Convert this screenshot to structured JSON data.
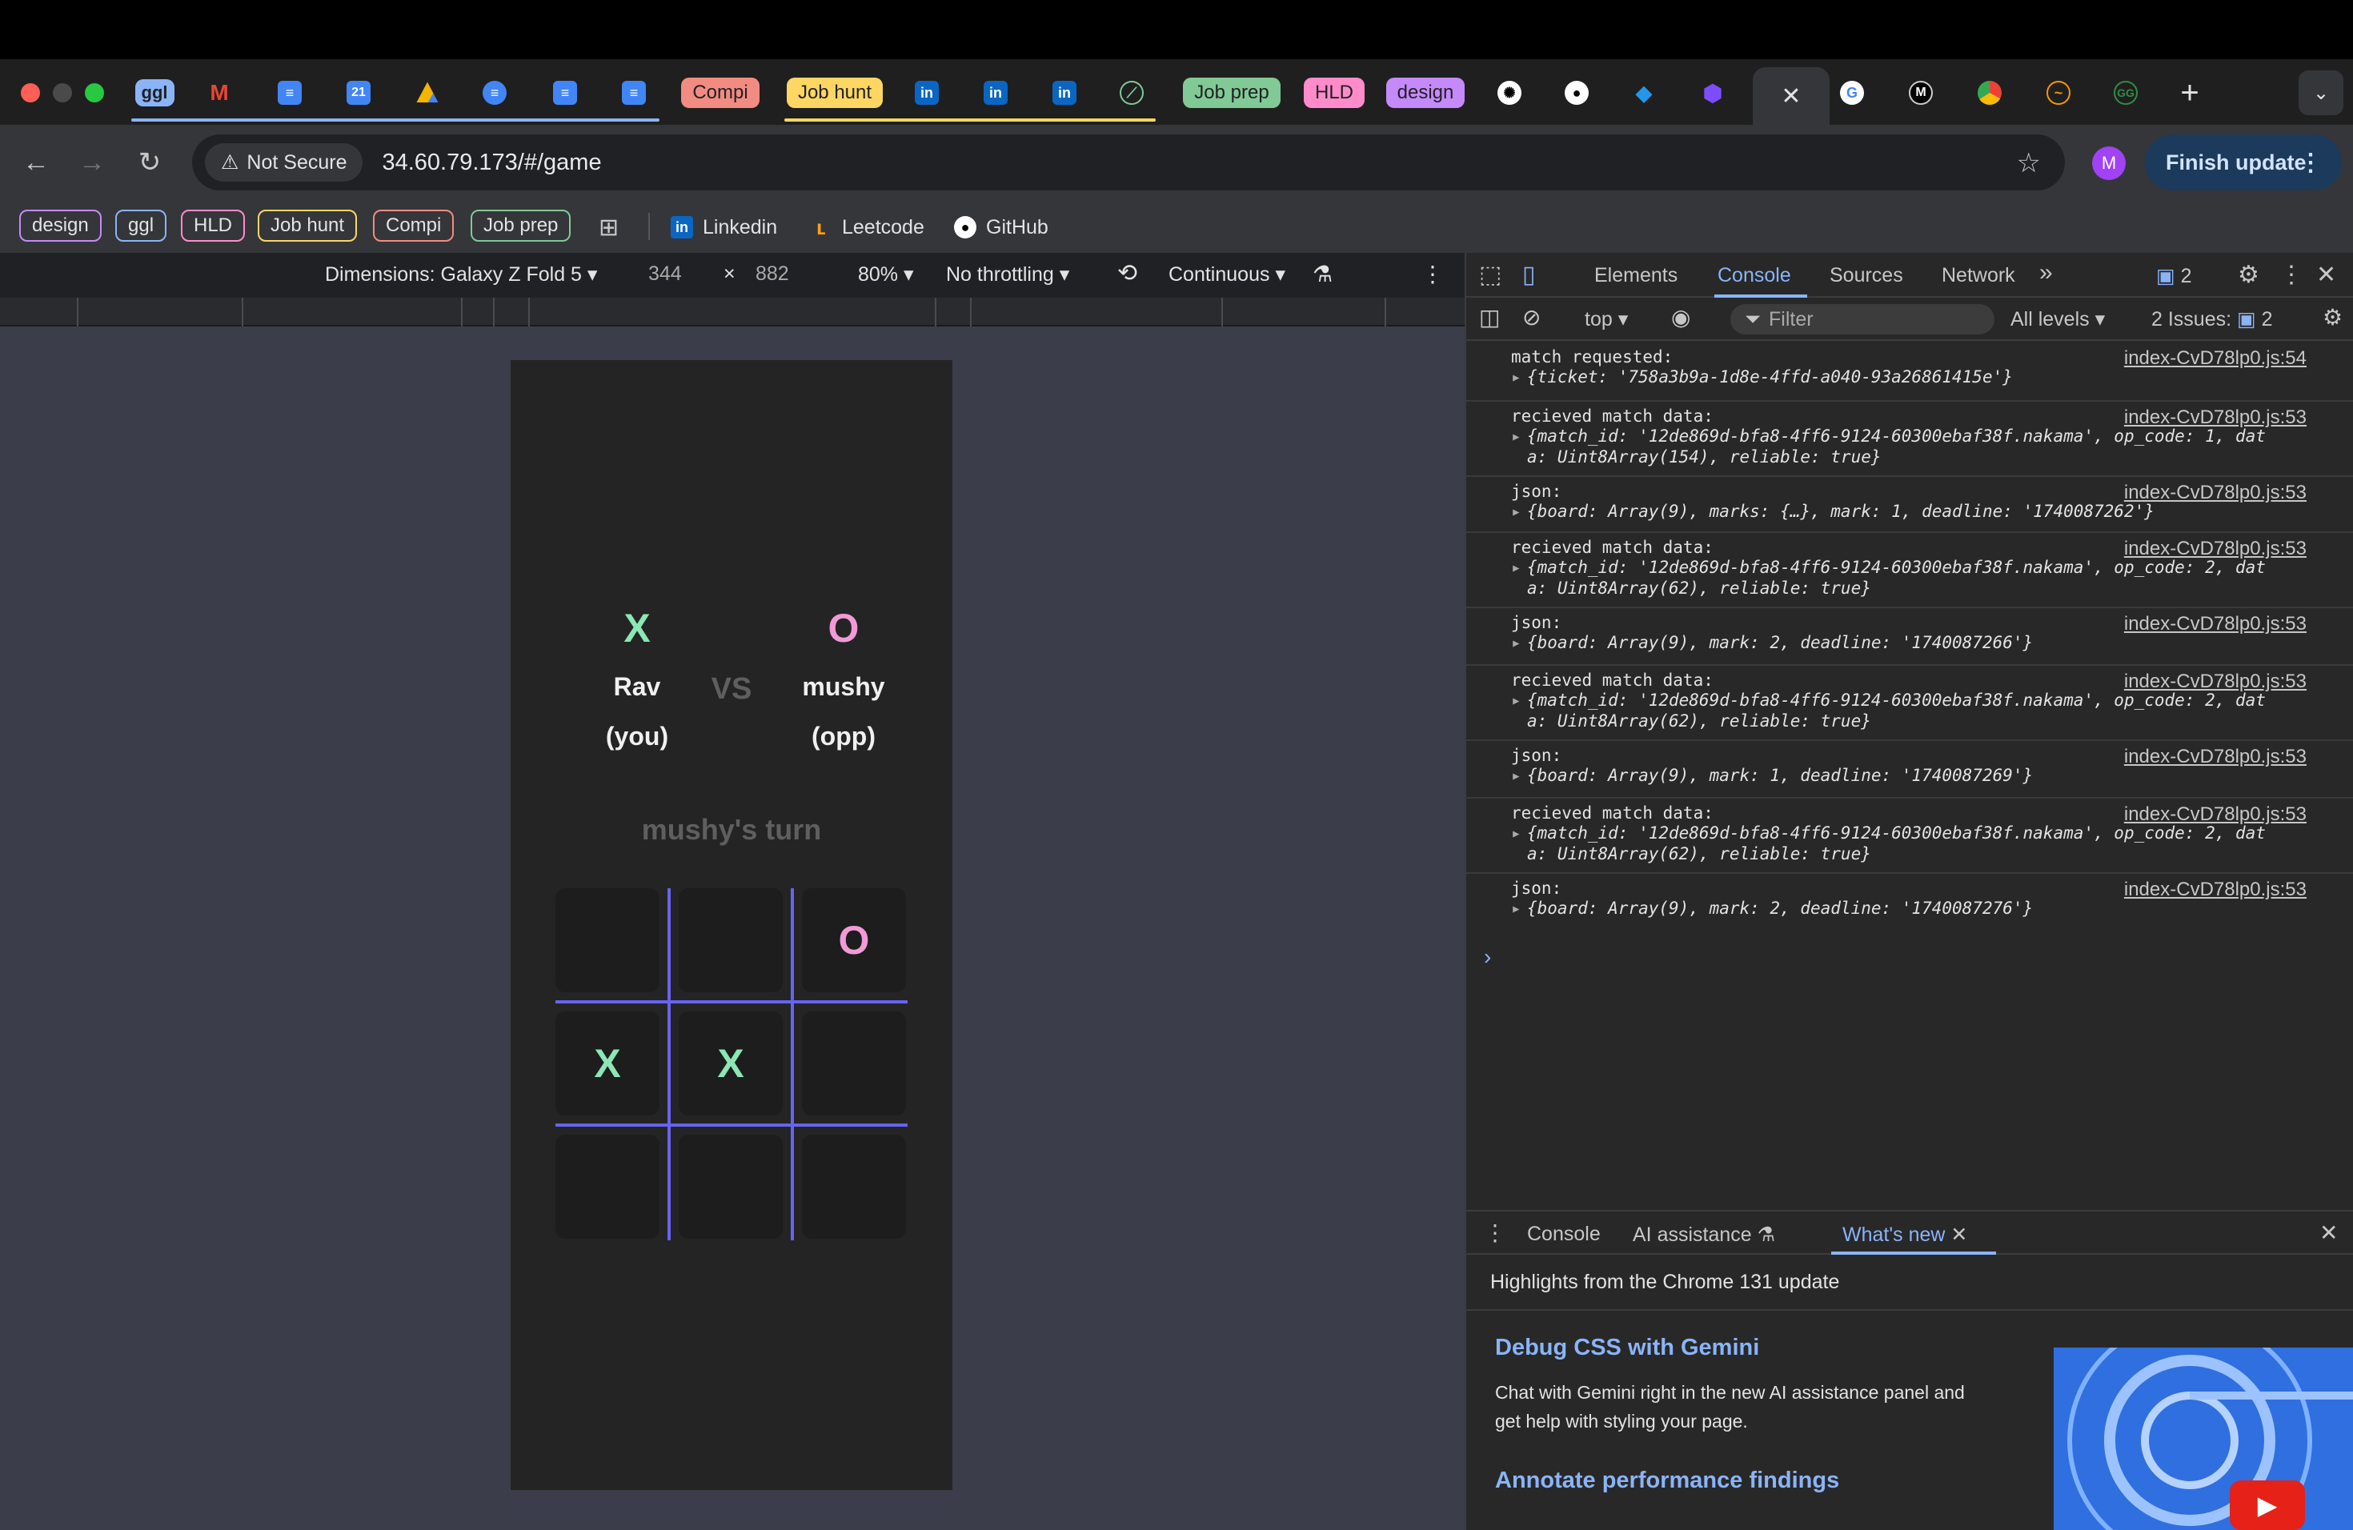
{
  "tabs": {
    "groups": [
      {
        "label": "ggl",
        "bg": "#8ab4f8",
        "fg": "#202124"
      },
      {
        "label": "Compi",
        "bg": "#f28b82",
        "fg": "#202124"
      },
      {
        "label": "Job hunt",
        "bg": "#fdd663",
        "fg": "#202124"
      },
      {
        "label": "Job prep",
        "bg": "#81c995",
        "fg": "#202124"
      },
      {
        "label": "HLD",
        "bg": "#ff8bcb",
        "fg": "#202124"
      },
      {
        "label": "design",
        "bg": "#c58af9",
        "fg": "#202124"
      }
    ],
    "calendar_day": "21",
    "new_tab": "+"
  },
  "toolbar": {
    "not_secure": "Not Secure",
    "url": "34.60.79.173/#/game",
    "avatar_letter": "M",
    "finish_update": "Finish update"
  },
  "bookmarks": {
    "groups": [
      {
        "label": "design",
        "color": "#c58af9"
      },
      {
        "label": "ggl",
        "color": "#8ab4f8"
      },
      {
        "label": "HLD",
        "color": "#ff8bcb"
      },
      {
        "label": "Job hunt",
        "color": "#fdd663"
      },
      {
        "label": "Compi",
        "color": "#f28b82"
      },
      {
        "label": "Job prep",
        "color": "#81c995"
      }
    ],
    "links": [
      {
        "label": "Linkedin"
      },
      {
        "label": "Leetcode"
      },
      {
        "label": "GitHub"
      }
    ]
  },
  "device_toolbar": {
    "dimensions": "Dimensions: Galaxy Z Fold 5",
    "width": "344",
    "times": "×",
    "height": "882",
    "zoom": "80%",
    "throttling": "No throttling",
    "mode": "Continuous"
  },
  "game": {
    "player1": {
      "mark": "X",
      "name": "Rav",
      "role": "(you)"
    },
    "vs": "VS",
    "player2": {
      "mark": "O",
      "name": "mushy",
      "role": "(opp)"
    },
    "turn_text": "mushy's turn",
    "board": [
      "",
      "",
      "O",
      "X",
      "X",
      "",
      "",
      "",
      ""
    ],
    "x_color": "#8ce7b4",
    "o_color": "#f29ad6",
    "grid_color": "#6464f0"
  },
  "devtools": {
    "tabs": [
      "Elements",
      "Console",
      "Sources",
      "Network"
    ],
    "active_tab": "Console",
    "more": "»",
    "issues_badge": "2",
    "context": "top",
    "filter_placeholder": "Filter",
    "levels": "All levels",
    "issues_label": "2 Issues:",
    "issues_count": "2",
    "log": [
      {
        "msg": "match requested:",
        "src": "index-CvD78lp0.js:54",
        "lines": [
          "{ticket: '758a3b9a-1d8e-4ffd-a040-93a26861415e'}"
        ]
      },
      {
        "msg": "recieved match data:",
        "src": "index-CvD78lp0.js:53",
        "lines": [
          "{match_id: '12de869d-bfa8-4ff6-9124-60300ebaf38f.nakama', op_code: 1, dat",
          "a: Uint8Array(154), reliable: true}"
        ]
      },
      {
        "msg": "json:",
        "src": "index-CvD78lp0.js:53",
        "lines": [
          "{board: Array(9), marks: {…}, mark: 1, deadline: '1740087262'}"
        ]
      },
      {
        "msg": "recieved match data:",
        "src": "index-CvD78lp0.js:53",
        "lines": [
          "{match_id: '12de869d-bfa8-4ff6-9124-60300ebaf38f.nakama', op_code: 2, dat",
          "a: Uint8Array(62), reliable: true}"
        ]
      },
      {
        "msg": "json:",
        "src": "index-CvD78lp0.js:53",
        "lines": [
          "{board: Array(9), mark: 2, deadline: '1740087266'}"
        ]
      },
      {
        "msg": "recieved match data:",
        "src": "index-CvD78lp0.js:53",
        "lines": [
          "{match_id: '12de869d-bfa8-4ff6-9124-60300ebaf38f.nakama', op_code: 2, dat",
          "a: Uint8Array(62), reliable: true}"
        ]
      },
      {
        "msg": "json:",
        "src": "index-CvD78lp0.js:53",
        "lines": [
          "{board: Array(9), mark: 1, deadline: '1740087269'}"
        ]
      },
      {
        "msg": "recieved match data:",
        "src": "index-CvD78lp0.js:53",
        "lines": [
          "{match_id: '12de869d-bfa8-4ff6-9124-60300ebaf38f.nakama', op_code: 2, dat",
          "a: Uint8Array(62), reliable: true}"
        ]
      },
      {
        "msg": "json:",
        "src": "index-CvD78lp0.js:53",
        "lines": [
          "{board: Array(9), mark: 2, deadline: '1740087276'}"
        ]
      }
    ],
    "prompt": "›",
    "drawer_tabs": [
      "Console",
      "AI assistance",
      "What's new"
    ],
    "whats_new": {
      "highlight": "Highlights from the Chrome 131 update",
      "heading1": "Debug CSS with Gemini",
      "body": "Chat with Gemini right in the new AI assistance panel and get help with styling your page.",
      "heading2": "Annotate performance findings"
    }
  }
}
